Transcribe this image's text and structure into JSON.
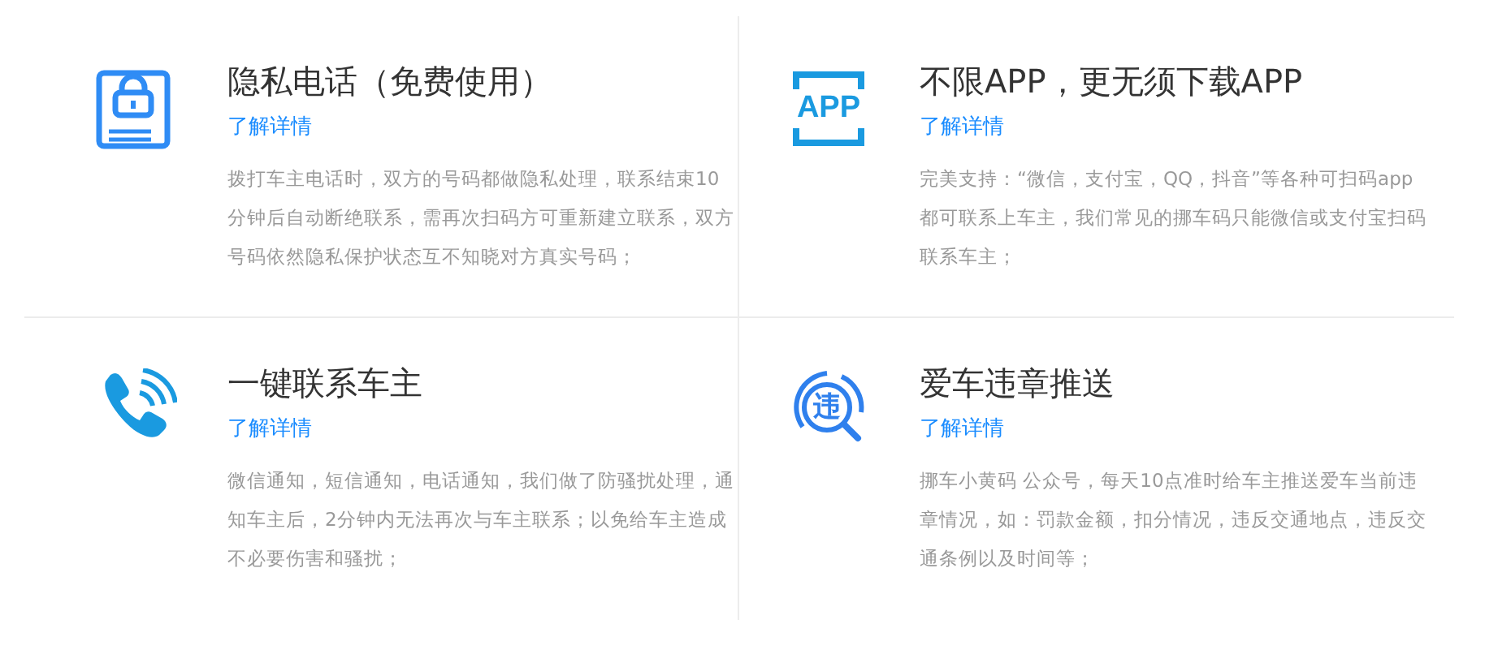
{
  "features": [
    {
      "kind": "lock",
      "title": "隐私电话（免费使用）",
      "link": "了解详情",
      "description": "拨打车主电话时，双方的号码都做隐私处理，联系结束10分钟后自动断绝联系，需再次扫码方可重新建立联系，双方号码依然隐私保护状态互不知晓对方真实号码；"
    },
    {
      "kind": "app",
      "icon_text": "APP",
      "title": "不限APP，更无须下载APP",
      "link": "了解详情",
      "description": "完美支持：“微信，支付宝，QQ，抖音”等各种可扫码app都可联系上车主，我们常见的挪车码只能微信或支付宝扫码联系车主；"
    },
    {
      "kind": "phone",
      "title": "一键联系车主",
      "link": "了解详情",
      "description": "微信通知，短信通知，电话通知，我们做了防骚扰处理，通知车主后，2分钟内无法再次与车主联系；以免给车主造成不必要伤害和骚扰；"
    },
    {
      "kind": "violation",
      "icon_text": "违",
      "title": "爱车违章推送",
      "link": "了解详情",
      "description": "挪车小黄码 公众号，每天10点准时给车主推送爱车当前违章情况，如：罚款金额，扣分情况，违反交通地点，违反交通条例以及时间等；"
    }
  ]
}
